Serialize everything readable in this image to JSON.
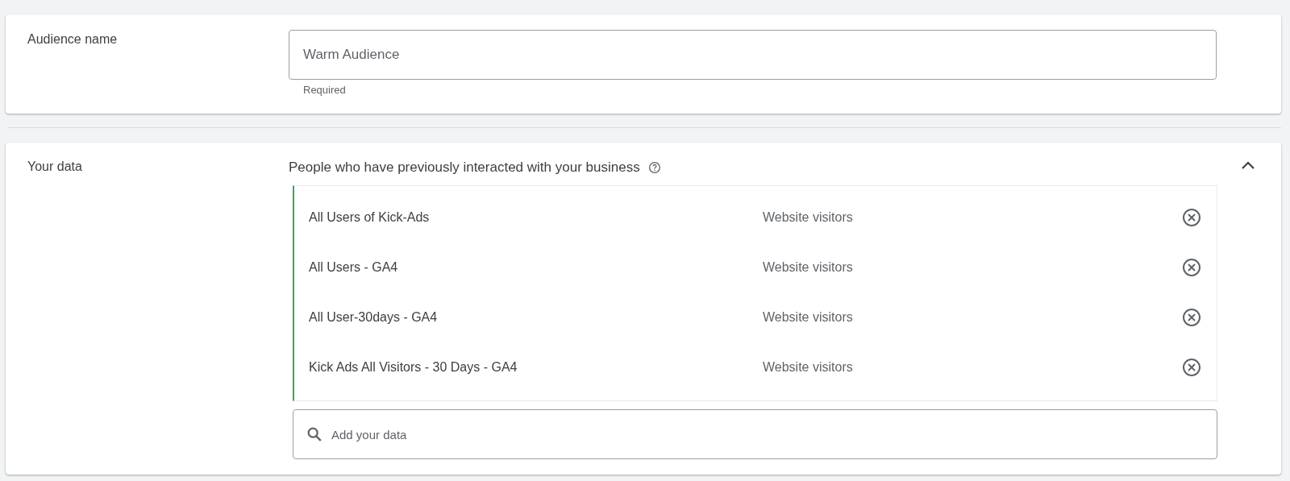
{
  "audience_name": {
    "label": "Audience name",
    "value": "Warm Audience",
    "helper": "Required"
  },
  "your_data": {
    "label": "Your data",
    "heading": "People who have previously interacted with your business",
    "expanded": true,
    "items": [
      {
        "name": "All Users of Kick-Ads",
        "type": "Website visitors"
      },
      {
        "name": "All Users - GA4",
        "type": "Website visitors"
      },
      {
        "name": "All User-30days - GA4",
        "type": "Website visitors"
      },
      {
        "name": "Kick Ads All Visitors - 30 Days - GA4",
        "type": "Website visitors"
      }
    ],
    "search": {
      "placeholder": "Add your data"
    }
  }
}
